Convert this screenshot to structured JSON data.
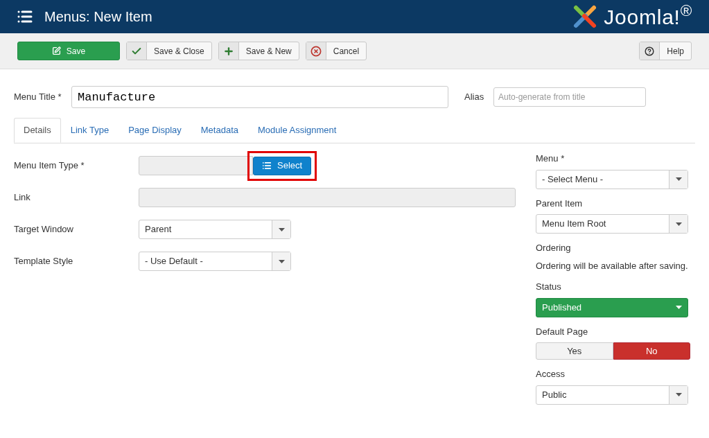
{
  "header": {
    "title": "Menus: New Item",
    "brand": "Joomla!$^{®}$"
  },
  "toolbar": {
    "buttons": [
      {
        "label": "Save",
        "kind": "save"
      },
      {
        "label": "Save & Close",
        "kind": "close"
      },
      {
        "label": "Save & New",
        "kind": "new"
      },
      {
        "label": "Cancel",
        "kind": "cancel"
      }
    ],
    "help_button": {
      "label": "Help"
    }
  },
  "title_field": {
    "label": "Menu Title *",
    "value": "Manufacture"
  },
  "alias_field": {
    "label": "Alias",
    "placeholder": "Auto-generate from title"
  },
  "tabs": [
    {
      "label": "Details",
      "selected": true
    },
    {
      "label": "Link Type",
      "selected": false
    },
    {
      "label": "Page Display",
      "selected": false
    },
    {
      "label": "Metadata",
      "selected": false
    },
    {
      "label": "Module Assignment",
      "selected": false
    }
  ],
  "left_fields": [
    {
      "kind": "type",
      "label": "Menu Item Type *",
      "button": "Select",
      "highlighted": true
    },
    {
      "kind": "text",
      "label": "Link"
    },
    {
      "kind": "select",
      "label": "Target Window",
      "value": "Parent"
    },
    {
      "kind": "select",
      "label": "Template Style",
      "value": "- Use Default -"
    }
  ],
  "right_fields": [
    {
      "kind": "select",
      "label": "Menu *",
      "value": "- Select Menu -"
    },
    {
      "kind": "select",
      "label": "Parent Item",
      "value": "Menu Item Root"
    },
    {
      "kind": "note",
      "label": "Ordering",
      "value": "Ordering will be available after saving."
    },
    {
      "kind": "status",
      "label": "Status",
      "value": "Published"
    },
    {
      "kind": "toggle",
      "label": "Default Page",
      "options": [
        {
          "label": "Yes",
          "selected": false
        },
        {
          "label": "No",
          "selected": true
        }
      ]
    },
    {
      "kind": "select",
      "label": "Access",
      "value": "Public"
    }
  ]
}
